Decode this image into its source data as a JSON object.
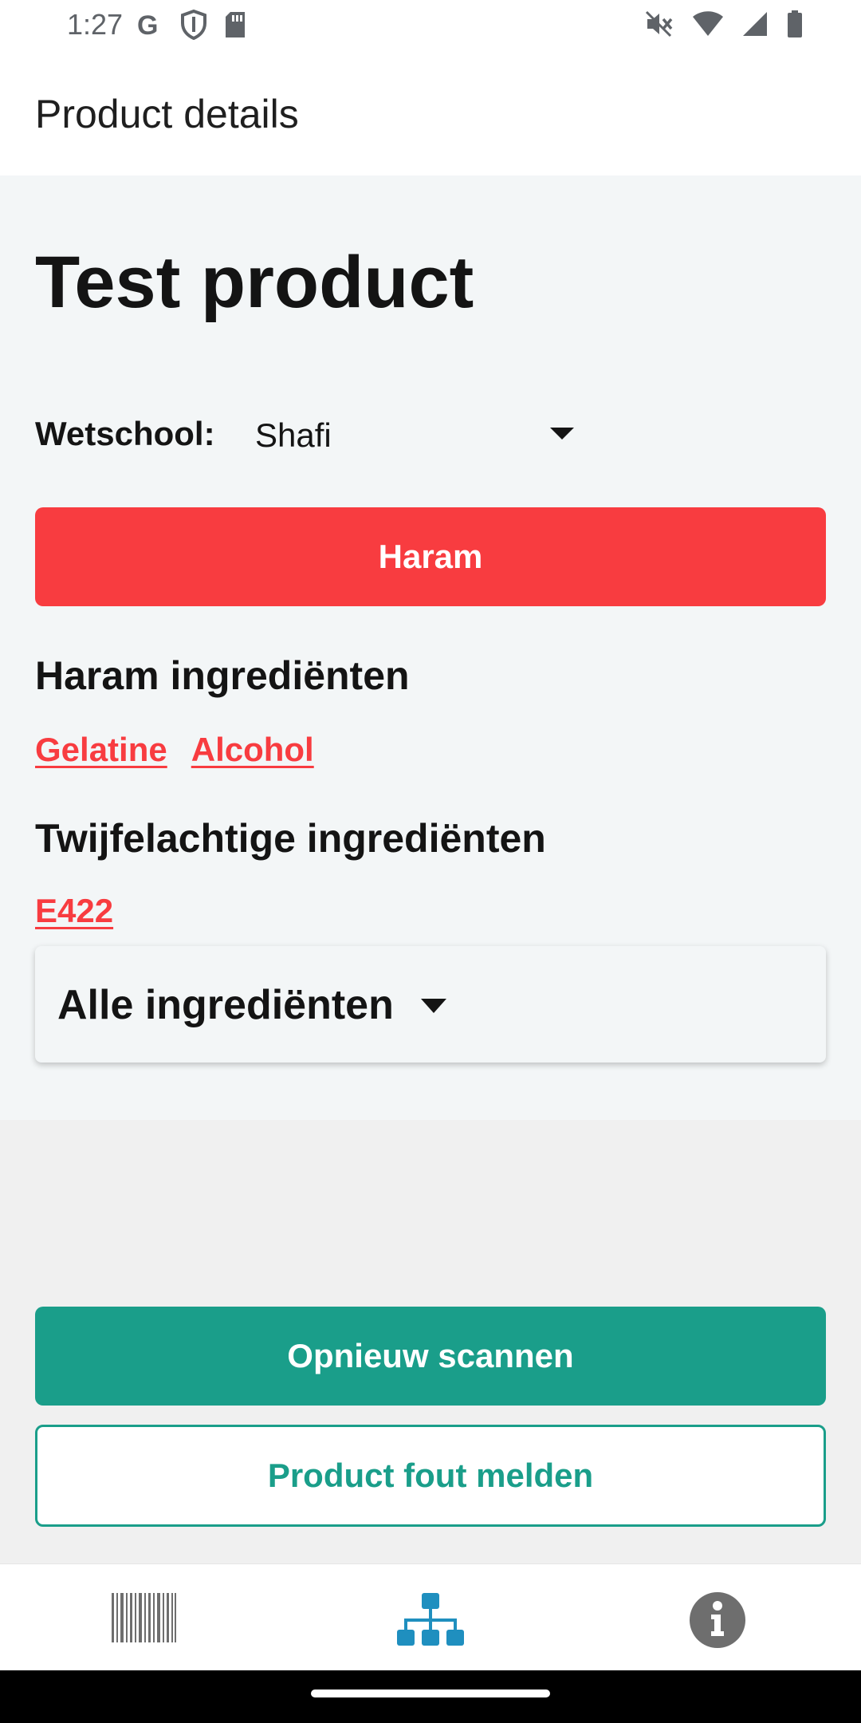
{
  "status_bar": {
    "time": "1:27",
    "icons_left": [
      "google-icon",
      "shield-icon",
      "sd-card-icon"
    ],
    "icons_right": [
      "mute-icon",
      "wifi-icon",
      "signal-icon",
      "battery-icon"
    ]
  },
  "app_bar": {
    "title": "Product details"
  },
  "product": {
    "name": "Test product",
    "wetschool_label": "Wetschool:",
    "wetschool_value": "Shafi",
    "verdict": "Haram",
    "verdict_color": "#f83c40"
  },
  "haram_section": {
    "title": "Haram ingrediënten",
    "items": [
      "Gelatine",
      "Alcohol"
    ]
  },
  "doubtful_section": {
    "title": "Twijfelachtige ingrediënten",
    "items": [
      "E422"
    ]
  },
  "all_ingredients": {
    "label": "Alle ingrediënten"
  },
  "actions": {
    "rescan_label": "Opnieuw scannen",
    "report_label": "Product fout melden",
    "accent_color": "#1a9e8a"
  },
  "bottom_nav": {
    "items": [
      {
        "icon": "barcode-icon",
        "active": false
      },
      {
        "icon": "sitemap-icon",
        "active": true
      },
      {
        "icon": "info-icon",
        "active": false
      }
    ],
    "active_color": "#1f8fbf",
    "inactive_color": "#6e6e6e"
  }
}
